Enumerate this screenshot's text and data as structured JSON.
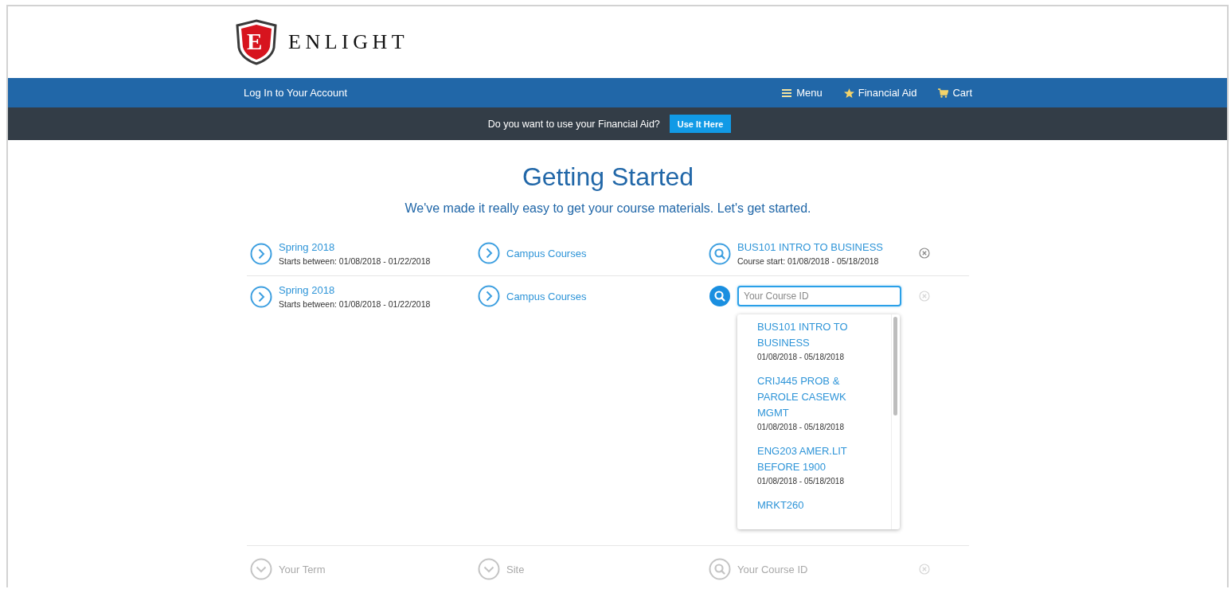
{
  "logo": {
    "letter": "E",
    "name": "ENLIGHT"
  },
  "nav": {
    "login": "Log In to Your Account",
    "links": [
      {
        "kind": "menu",
        "label": "Menu"
      },
      {
        "kind": "star",
        "label": "Financial Aid"
      },
      {
        "kind": "cart",
        "label": "Cart"
      }
    ]
  },
  "aid_bar": {
    "question": "Do you want to use your Financial Aid?",
    "button": "Use It Here"
  },
  "heading": "Getting Started",
  "subheading": "We've made it really easy to get your course materials. Let's get started.",
  "rows": [
    {
      "kind": "done",
      "term": {
        "label": "Spring 2018",
        "detail": "Starts between: 01/08/2018 - 01/22/2018"
      },
      "site": {
        "label": "Campus Courses"
      },
      "course": {
        "label": "BUS101 INTRO TO BUSINESS",
        "detail": "Course start: 01/08/2018 - 05/18/2018"
      }
    },
    {
      "kind": "active",
      "term": {
        "label": "Spring 2018",
        "detail": "Starts between: 01/08/2018 - 01/22/2018"
      },
      "site": {
        "label": "Campus Courses"
      },
      "course": {
        "placeholder": "Your Course ID",
        "suggestions": [
          {
            "title": "BUS101 INTRO TO BUSINESS",
            "dates": "01/08/2018 - 05/18/2018"
          },
          {
            "title": "CRIJ445 PROB & PAROLE CASEWK MGMT",
            "dates": "01/08/2018 - 05/18/2018"
          },
          {
            "title": "ENG203 AMER.LIT BEFORE 1900",
            "dates": "01/08/2018 - 05/18/2018"
          },
          {
            "title": "MRKT260"
          }
        ]
      }
    },
    {
      "kind": "pending",
      "term": {
        "label": "Your Term"
      },
      "site": {
        "label": "Site"
      },
      "course": {
        "label": "Your Course ID"
      }
    }
  ]
}
